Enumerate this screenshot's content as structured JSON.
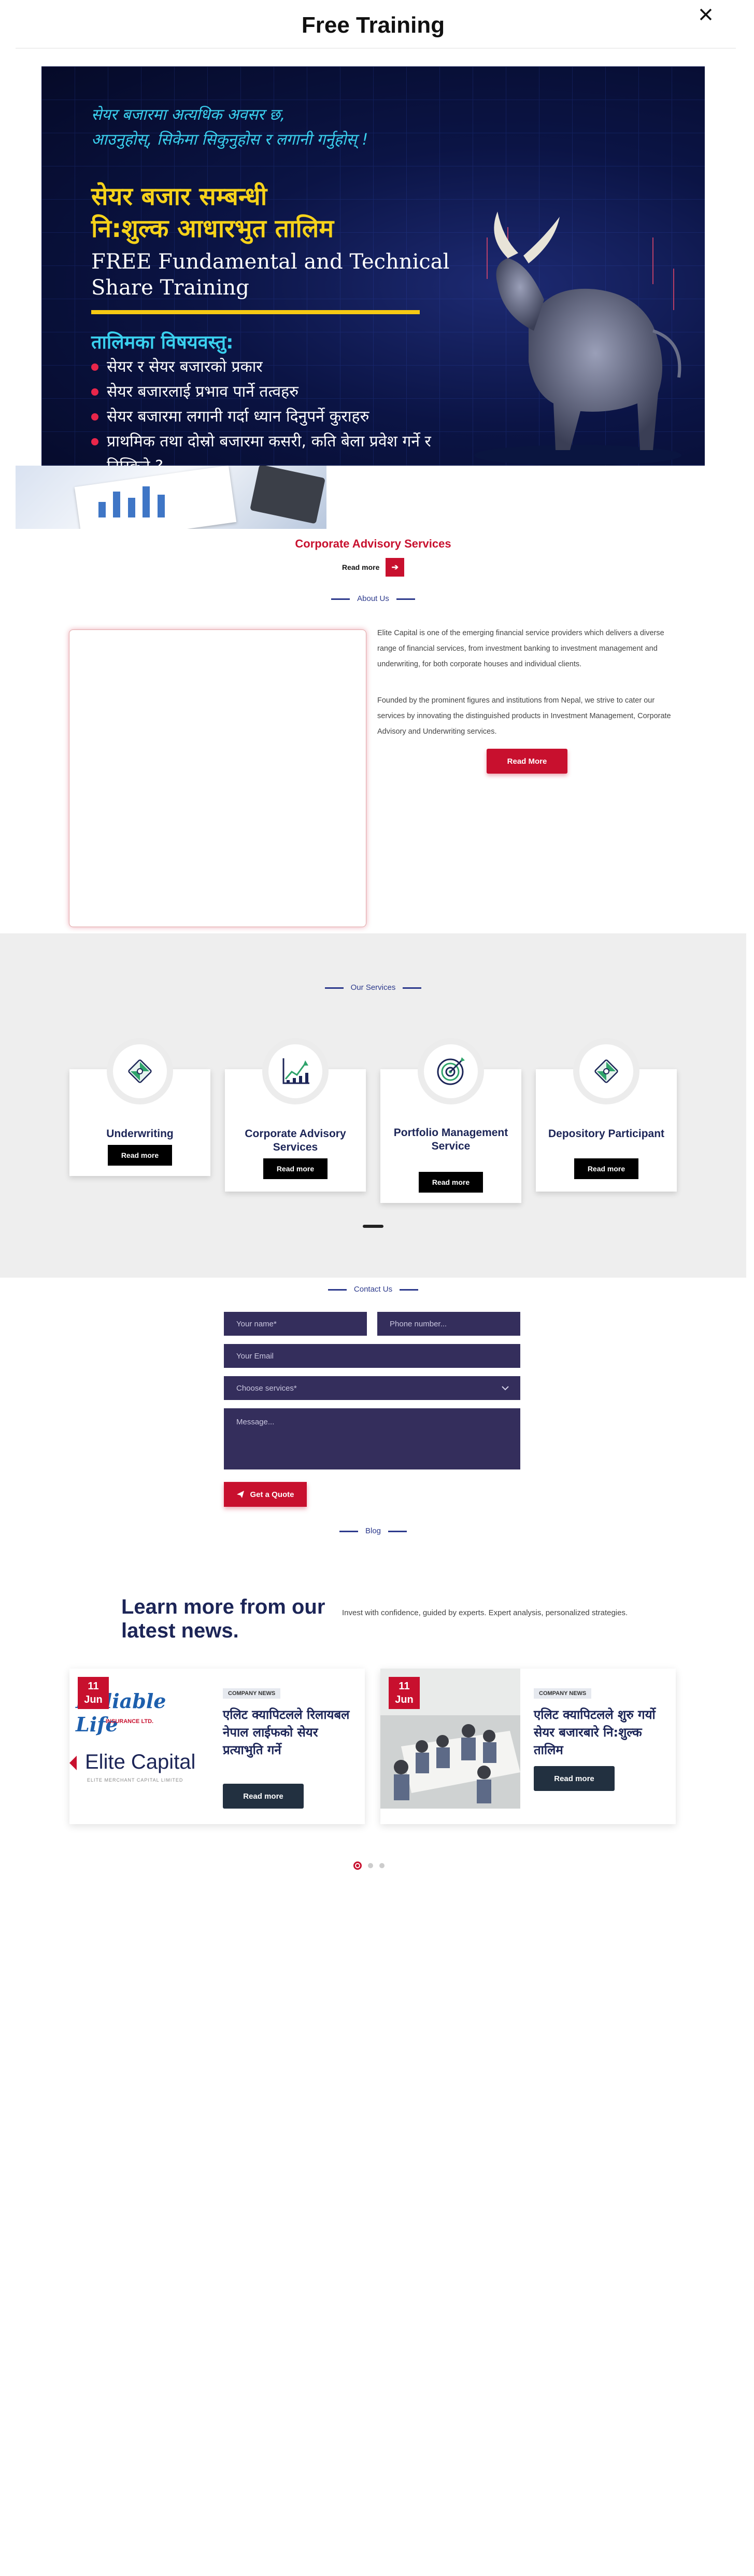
{
  "modal": {
    "title": "Free Training",
    "close_icon": "close-icon"
  },
  "banner": {
    "intro_line1": "सेयर बजारमा अत्यधिक अवसर छ,",
    "intro_line2": "आउनुहोस्, सिकेमा सिकुनुहोस र लगानी गर्नुहोस् !",
    "title_line1": "सेयर बजार सम्बन्धी",
    "title_line2": "नि:शुल्क आधारभुत तालिम",
    "english_line1": "FREE Fundamental and Technical",
    "english_line2": "Share Training",
    "subtitle": "तालिमका विषयवस्तु:",
    "topics": [
      "सेयर र सेयर बजारको प्रकार",
      "सेयर बजारलाई प्रभाव पार्ने तत्वहरु",
      "सेयर बजारमा लगानी गर्दा ध्यान दिनुपर्ने कुराहरु",
      "प्राथमिक तथा दोस्रो बजारमा कसरी, कति बेला प्रवेश गर्ने र निस्किने ?"
    ]
  },
  "slider": {
    "title": "Corporate Advisory Services",
    "read_more": "Read more",
    "arrow_icon": "arrow-right-icon"
  },
  "about": {
    "label": "About Us",
    "paragraph1": "Elite Capital is one of the emerging financial service providers which delivers a diverse range of financial services, from investment banking to investment management and underwriting, for both corporate houses and individual clients.",
    "paragraph2": "Founded by the prominent figures and institutions from Nepal, we strive to cater our services by innovating the distinguished products in Investment Management, Corporate Advisory and Underwriting services.",
    "button": "Read More"
  },
  "services": {
    "label": "Our Services",
    "items": [
      {
        "name": "Underwriting",
        "button": "Read more",
        "icon": "puzzle-icon"
      },
      {
        "name": "Corporate Advisory Services",
        "button": "Read more",
        "icon": "growth-chart-icon"
      },
      {
        "name": "Portfolio Management Service",
        "button": "Read more",
        "icon": "target-icon"
      },
      {
        "name": "Depository Participant",
        "button": "Read more",
        "icon": "puzzle-icon"
      }
    ]
  },
  "contact": {
    "label": "Contact Us",
    "name_placeholder": "Your name*",
    "phone_placeholder": "Phone number...",
    "email_placeholder": "Your Email",
    "service_placeholder": "Choose services*",
    "message_placeholder": "Message...",
    "button": "Get a Quote"
  },
  "blog": {
    "label": "Blog",
    "heading": "Learn more from our latest news.",
    "intro": "Invest with confidence, guided by experts. Expert analysis, personalized strategies.",
    "posts": [
      {
        "day": "11",
        "month": "Jun",
        "tag": "COMPANY NEWS",
        "title": "एलिट क्यापिटलले रिलायबल नेपाल लाईफको सेयर प्रत्याभुति गर्ने",
        "button": "Read more",
        "logo1": "Reliable Life",
        "logo1_sub": "INSURANCE LTD.",
        "logo2": "Elite Capital",
        "logo2_sub": "ELITE MERCHANT CAPITAL LIMITED"
      },
      {
        "day": "11",
        "month": "Jun",
        "tag": "COMPANY NEWS",
        "title": "एलिट क्यापिटलले शुरु गर्यो सेयर बजारबारे नि:शुल्क तालिम",
        "button": "Read more"
      }
    ]
  },
  "colors": {
    "brand_red": "#c8102e",
    "navy": "#1c2557",
    "form_field": "#342e5c"
  }
}
